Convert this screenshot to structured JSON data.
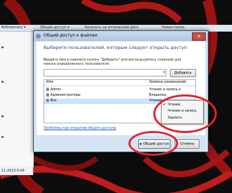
{
  "explorer": {
    "toolbar": [
      "библиотеку ▾",
      "Общий доступ ▾",
      "Записать на оптический диск",
      "Новая папка"
    ],
    "status_time": "11.2013 6:45"
  },
  "dialog": {
    "title": "Общий доступ к файлам",
    "heading": "Выберите пользователей, которым следует открыть доступ",
    "hint": "Введите имя и нажмите кнопку \"Добавить\" или воспользуйтесь стрелкой для поиска определенного пользователя.",
    "add_label": "Добавить",
    "columns": [
      "Имя",
      "Уровень разрешений"
    ],
    "rows": [
      {
        "name": "Admin",
        "perm": "Чтение и запись ▾"
      },
      {
        "name": "Администраторы",
        "perm": "Владелец"
      },
      {
        "name": "Все",
        "perm": "Чтение ▾"
      }
    ],
    "problem_link": "Проблемы при открытии общего доступа",
    "share_label": "Общий доступ",
    "cancel_label": "Отмена"
  },
  "menu": {
    "items": [
      {
        "label": "Чтение",
        "checked": true
      },
      {
        "label": "Чтение и запись",
        "checked": false
      },
      {
        "label": "Удалить",
        "checked": false
      }
    ]
  },
  "colors": {
    "highlight": "#e0262a",
    "title_bar": "#b6cde7",
    "accent": "#1e3d8f"
  }
}
